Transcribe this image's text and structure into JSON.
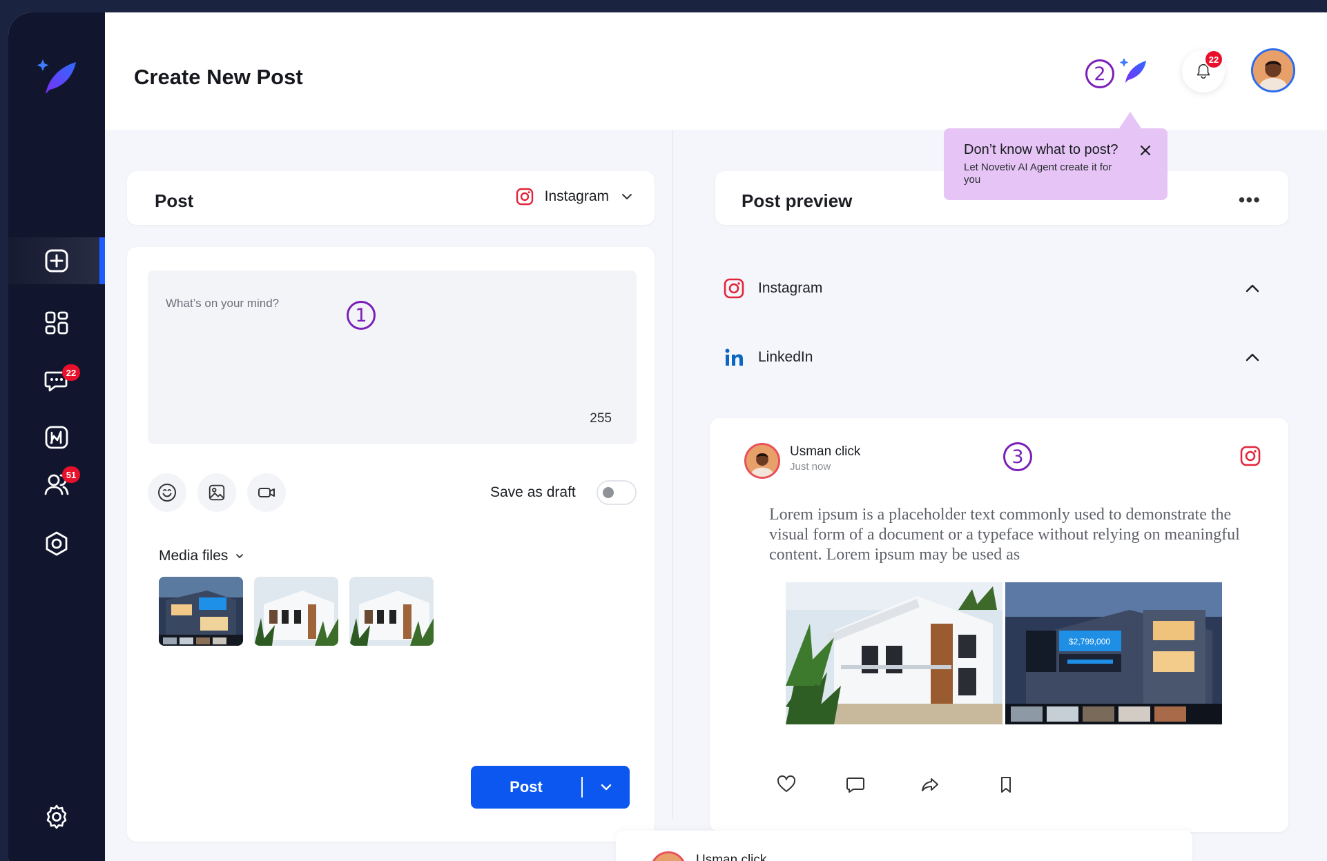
{
  "app": {
    "title": "Create New Post"
  },
  "sidebar": {
    "items": [
      {
        "id": "create",
        "icon": "plus-square-icon",
        "active": true
      },
      {
        "id": "dashboard",
        "icon": "grid-icon"
      },
      {
        "id": "messages",
        "icon": "message-icon",
        "badge": "22"
      },
      {
        "id": "analytics",
        "icon": "chart-icon"
      },
      {
        "id": "users",
        "icon": "users-icon",
        "badge": "51"
      },
      {
        "id": "automation",
        "icon": "gear-badge-icon"
      },
      {
        "id": "settings",
        "icon": "settings-icon"
      }
    ]
  },
  "header": {
    "notifications_count": "22",
    "annotation": "2"
  },
  "tooltip": {
    "title": "Don’t know what to post?",
    "body": "Let Novetiv AI Agent create it for you"
  },
  "composer": {
    "section_title": "Post",
    "platform": "Instagram",
    "placeholder": "What’s on your mind?",
    "char_count": "255",
    "annotation": "1",
    "save_draft_label": "Save as draft",
    "save_draft_on": false,
    "media_label": "Media files",
    "post_button": "Post"
  },
  "preview": {
    "section_title": "Post preview",
    "platforms": [
      {
        "name": "Instagram",
        "icon": "instagram-icon"
      },
      {
        "name": "LinkedIn",
        "icon": "linkedin-icon"
      }
    ],
    "card": {
      "user": "Usman click",
      "time": "Just now",
      "annotation": "3",
      "text": "Lorem ipsum is a placeholder text commonly used to demonstrate the visual form of a document or a typeface without relying on meaningful content. Lorem ipsum may be used as",
      "image_price": "$2,799,000"
    },
    "next_card_user": "Usman click"
  },
  "colors": {
    "accent": "#0b57f0",
    "sidebar": "#11162e",
    "badge": "#e8102a",
    "tooltip": "#e6c5f6",
    "annotation": "#7a1fb8"
  }
}
